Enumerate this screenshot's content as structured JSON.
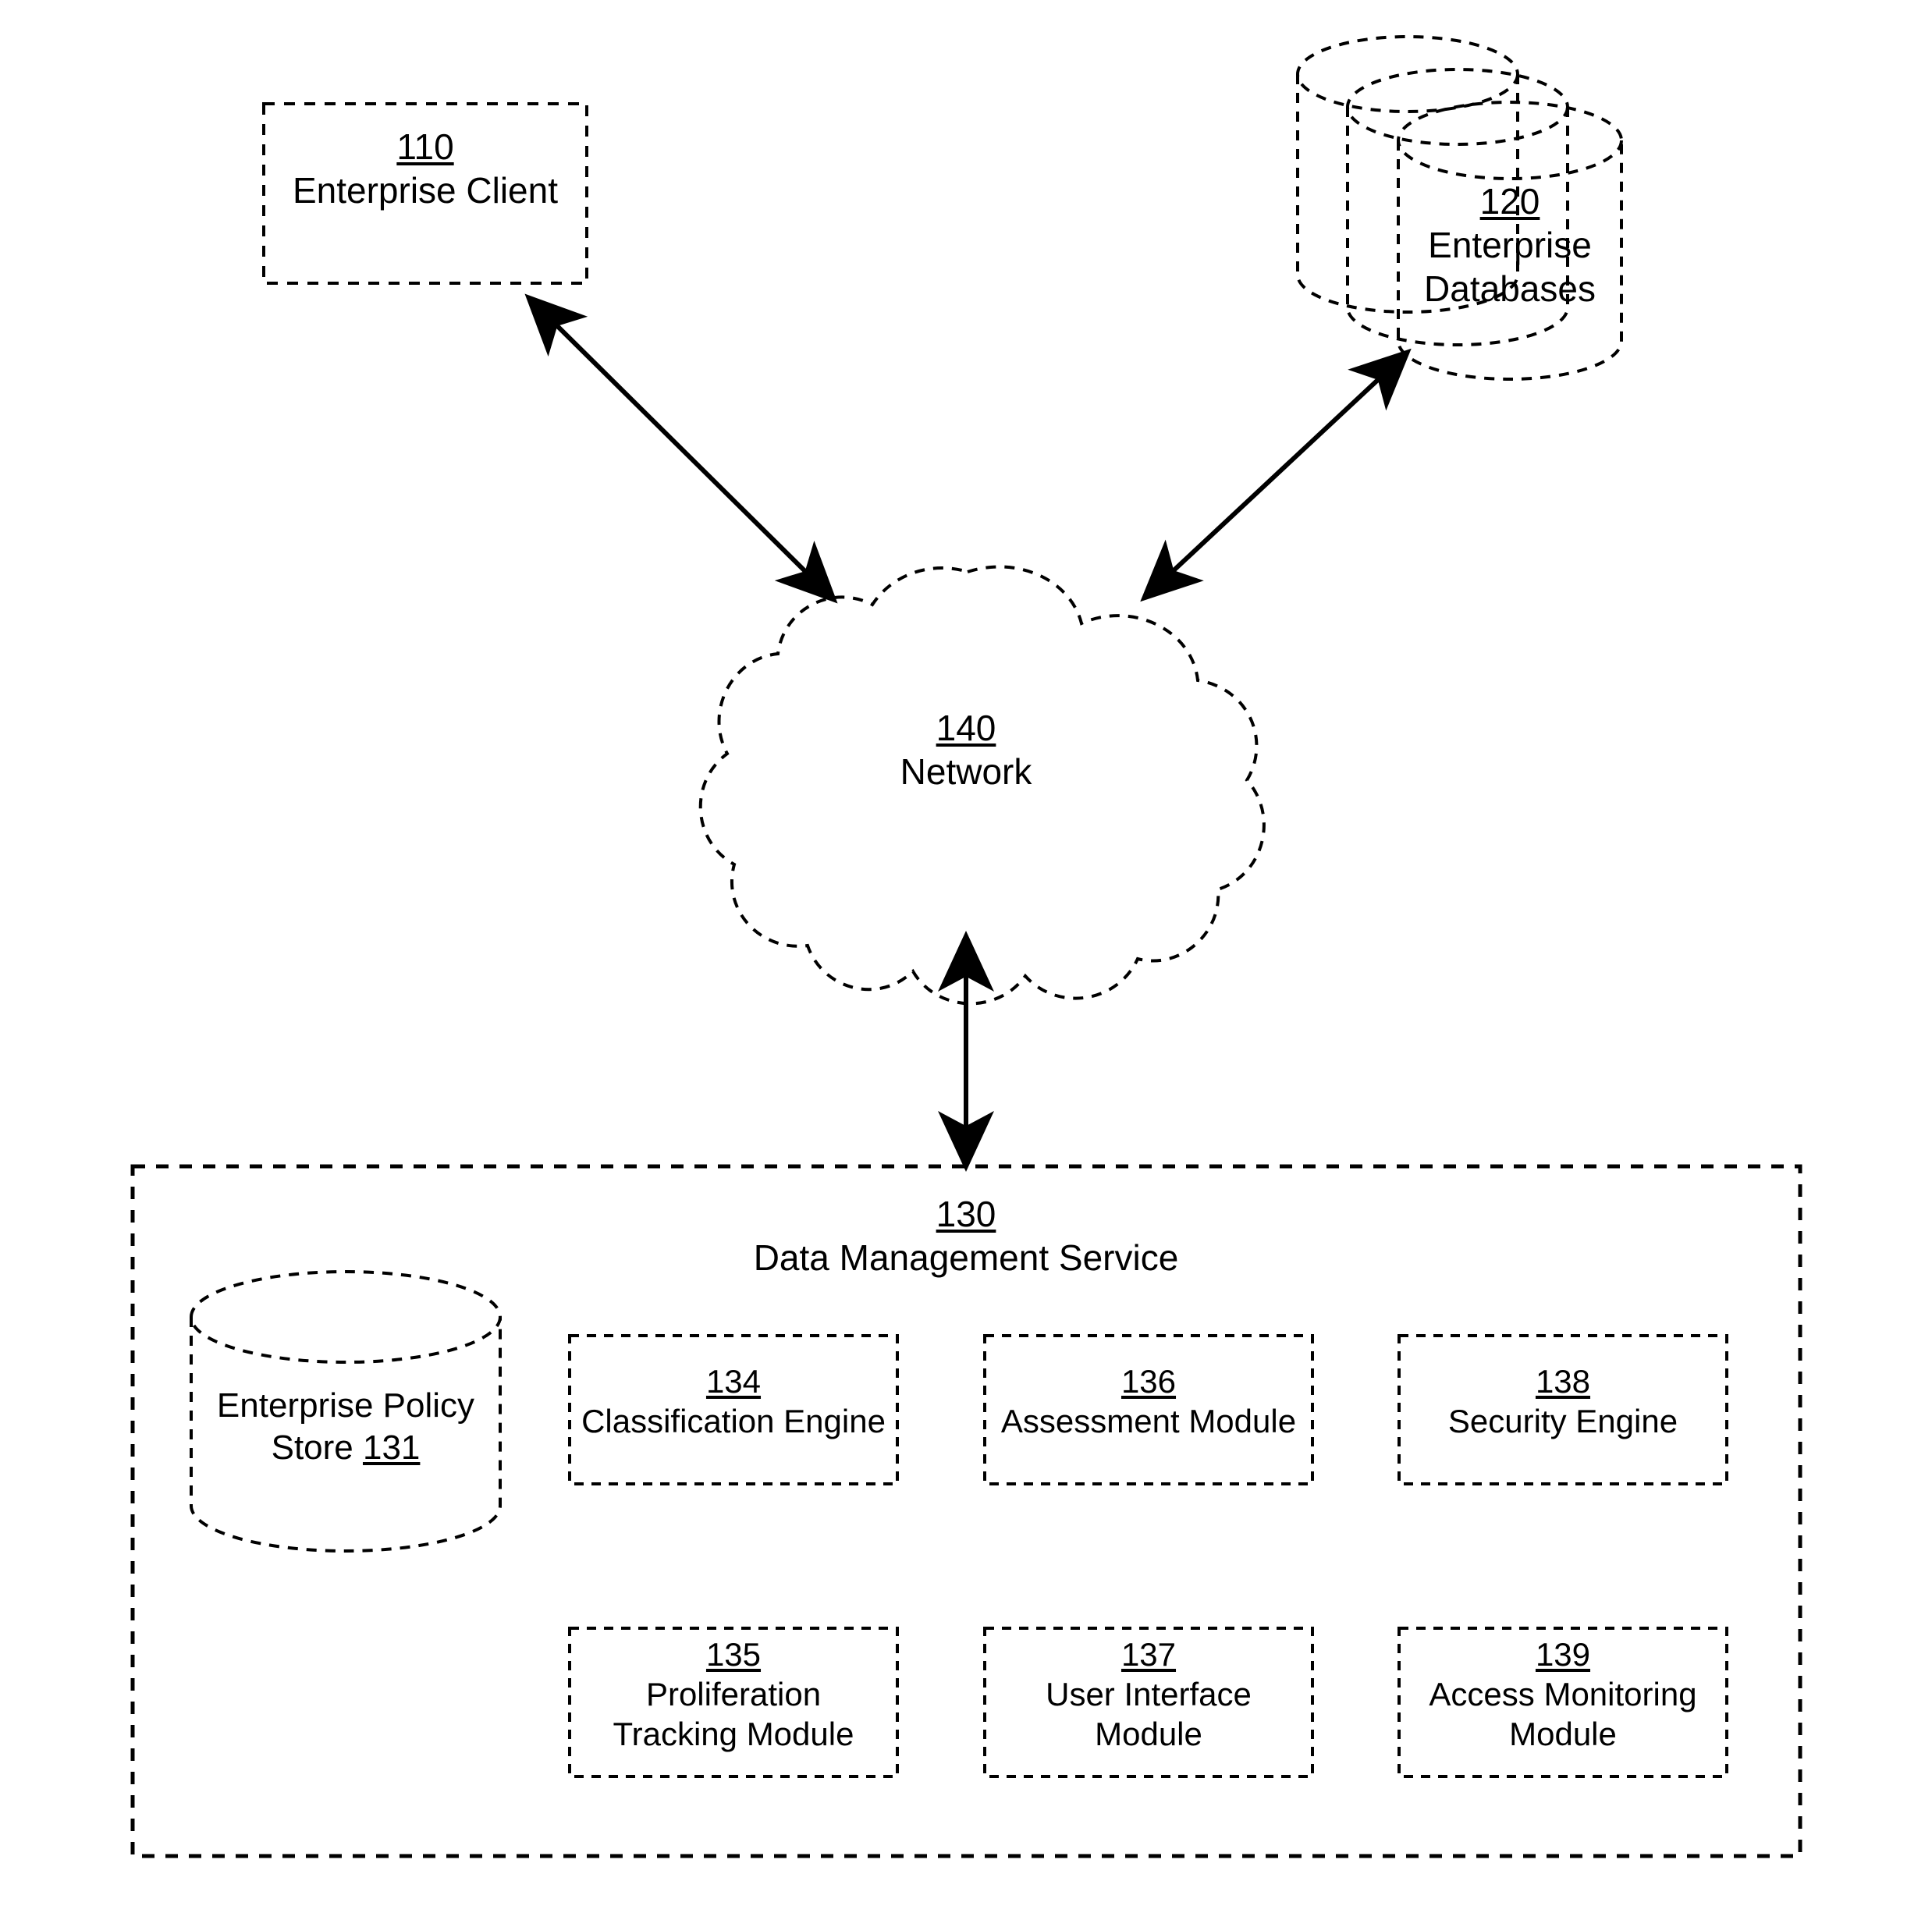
{
  "figure": {
    "type": "system-architecture-block-diagram",
    "style": "patent-drawing, dashed outlines, black and white",
    "line_color": "#000000",
    "background_color": "#ffffff"
  },
  "nodes": {
    "enterprise_client": {
      "ref": "110",
      "label": "Enterprise Client",
      "shape": "dashed-rectangle"
    },
    "enterprise_databases": {
      "ref": "120",
      "label_line1": "Enterprise",
      "label_line2": "Databases",
      "shape": "stacked-dashed-cylinders",
      "count": 3
    },
    "network": {
      "ref": "140",
      "label": "Network",
      "shape": "dashed-cloud"
    },
    "data_management_service": {
      "ref": "130",
      "label": "Data Management Service",
      "shape": "dashed-rectangle-container"
    },
    "enterprise_policy_store": {
      "label_line1": "Enterprise Policy",
      "label_line2_text": "Store ",
      "ref": "131",
      "shape": "dashed-cylinder"
    }
  },
  "modules": [
    {
      "ref": "134",
      "line1": "Classification Engine",
      "line2": ""
    },
    {
      "ref": "136",
      "line1": "Assessment Module",
      "line2": ""
    },
    {
      "ref": "138",
      "line1": "Security Engine",
      "line2": ""
    },
    {
      "ref": "135",
      "line1": "Proliferation",
      "line2": "Tracking Module"
    },
    {
      "ref": "137",
      "line1": "User Interface",
      "line2": "Module"
    },
    {
      "ref": "139",
      "line1": "Access Monitoring",
      "line2": "Module"
    }
  ],
  "connections": [
    {
      "from": "enterprise_client",
      "to": "network",
      "style": "double-headed-arrow"
    },
    {
      "from": "enterprise_databases",
      "to": "network",
      "style": "double-headed-arrow"
    },
    {
      "from": "network",
      "to": "data_management_service",
      "style": "double-headed-arrow"
    }
  ]
}
